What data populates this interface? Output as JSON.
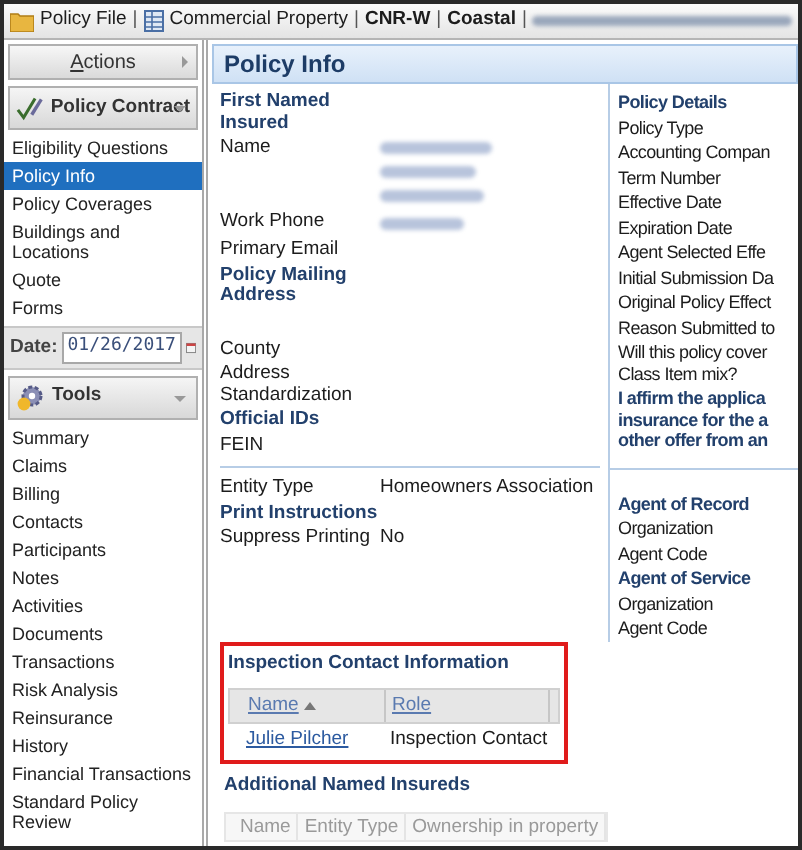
{
  "breadcrumb": [
    {
      "kind": "folder",
      "label": "Policy File"
    },
    {
      "kind": "separator",
      "label": "|"
    },
    {
      "kind": "table",
      "label": "Commercial Property"
    },
    {
      "kind": "separator",
      "label": "|"
    },
    {
      "kind": "strong",
      "label": "CNR-W"
    },
    {
      "kind": "separator",
      "label": "|"
    },
    {
      "kind": "strong",
      "label": "Coastal"
    },
    {
      "kind": "separator",
      "label": "|"
    },
    {
      "kind": "blurred"
    }
  ],
  "sidebar": {
    "actions_button": "Actions",
    "sections": [
      {
        "kind": "contract",
        "title": "Policy Contract",
        "items": [
          {
            "label": "Eligibility Questions",
            "selected": false
          },
          {
            "label": "Policy Info",
            "selected": true
          },
          {
            "label": "Policy Coverages",
            "selected": false
          },
          {
            "label": "Buildings and Locations",
            "selected": false
          },
          {
            "label": "Quote",
            "selected": false
          },
          {
            "label": "Forms",
            "selected": false
          }
        ],
        "date_field": {
          "label": "Date:",
          "value": "01/26/2017"
        }
      },
      {
        "kind": "tools",
        "title": "Tools",
        "items": [
          {
            "label": "Summary",
            "selected": false
          },
          {
            "label": "Claims",
            "selected": false
          },
          {
            "label": "Billing",
            "selected": false
          },
          {
            "label": "Contacts",
            "selected": false
          },
          {
            "label": "Participants",
            "selected": false
          },
          {
            "label": "Notes",
            "selected": false
          },
          {
            "label": "Activities",
            "selected": false
          },
          {
            "label": "Documents",
            "selected": false
          },
          {
            "label": "Transactions",
            "selected": false
          },
          {
            "label": "Risk Analysis",
            "selected": false
          },
          {
            "label": "Reinsurance",
            "selected": false
          },
          {
            "label": "History",
            "selected": false
          },
          {
            "label": "Financial Transactions",
            "selected": false
          },
          {
            "label": "Standard Policy Review",
            "selected": false
          }
        ]
      }
    ]
  },
  "main": {
    "title": "Policy Info",
    "left_column": [
      {
        "kind": "heading",
        "label": "First Named Insured"
      },
      {
        "kind": "blurblock",
        "label": "Name"
      },
      {
        "kind": "blurline",
        "label": "Work Phone"
      },
      {
        "kind": "field",
        "label": "Primary Email"
      },
      {
        "kind": "heading",
        "label": "Policy Mailing Address"
      },
      {
        "kind": "spacer"
      },
      {
        "kind": "field",
        "label": "County"
      },
      {
        "kind": "field",
        "label": "Address Standardization"
      },
      {
        "kind": "heading",
        "label": "Official IDs"
      },
      {
        "kind": "field",
        "label": "FEIN"
      },
      {
        "kind": "divider"
      },
      {
        "kind": "field",
        "label": "Entity Type",
        "value": "Homeowners Association"
      },
      {
        "kind": "heading",
        "label": "Print Instructions"
      },
      {
        "kind": "field",
        "label": "Suppress Printing",
        "value": "No"
      }
    ],
    "right_column": [
      {
        "kind": "heading",
        "lines": [
          "Policy Details"
        ]
      },
      {
        "kind": "field",
        "lines": [
          "Policy Type"
        ]
      },
      {
        "kind": "field",
        "lines": [
          "Accounting Compan"
        ]
      },
      {
        "kind": "field",
        "lines": [
          "Term Number"
        ]
      },
      {
        "kind": "field",
        "lines": [
          "Effective Date"
        ]
      },
      {
        "kind": "field",
        "lines": [
          "Expiration Date"
        ]
      },
      {
        "kind": "field",
        "lines": [
          "Agent Selected Effe"
        ]
      },
      {
        "kind": "field",
        "lines": [
          "Initial Submission Da"
        ]
      },
      {
        "kind": "field",
        "lines": [
          "Original Policy Effect"
        ]
      },
      {
        "kind": "field",
        "lines": [
          "Reason Submitted to"
        ]
      },
      {
        "kind": "field",
        "lines": [
          "Will this policy cover",
          "Class Item mix?"
        ]
      },
      {
        "kind": "heading",
        "lines": [
          "I affirm the applica",
          "insurance for the a",
          "other offer from an"
        ]
      },
      {
        "kind": "divider"
      },
      {
        "kind": "heading",
        "lines": [
          "Agent of Record"
        ]
      },
      {
        "kind": "field",
        "lines": [
          "Organization"
        ]
      },
      {
        "kind": "field",
        "lines": [
          "Agent Code"
        ]
      },
      {
        "kind": "heading",
        "lines": [
          "Agent of Service"
        ]
      },
      {
        "kind": "field",
        "lines": [
          "Organization"
        ]
      },
      {
        "kind": "field",
        "lines": [
          "Agent Code"
        ]
      }
    ],
    "inspection_contacts": {
      "title": "Inspection Contact Information",
      "highlighted": true,
      "columns": [
        {
          "label": "Name",
          "sorted": true
        },
        {
          "label": "Role",
          "sorted": false
        }
      ],
      "rows": [
        [
          "Julie Pilcher",
          "Inspection Contact"
        ]
      ]
    },
    "additional_named_insureds": {
      "title": "Additional Named Insureds",
      "columns": [
        {
          "label": "Name",
          "disabled": true
        },
        {
          "label": "Entity Type",
          "disabled": true
        },
        {
          "label": "Ownership in property",
          "disabled": true
        }
      ]
    }
  }
}
